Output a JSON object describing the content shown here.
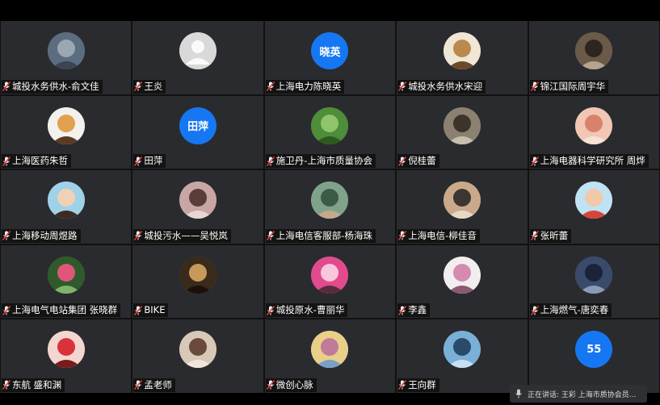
{
  "participants": [
    {
      "name": "城投水务供水-俞文佳",
      "avatar": {
        "type": "pic",
        "colors": [
          "#5b6d7e",
          "#9aa8b4",
          "#3a4452"
        ]
      }
    },
    {
      "name": "王炎",
      "avatar": {
        "type": "default"
      }
    },
    {
      "name": "上海电力陈晓英",
      "avatar": {
        "type": "text",
        "text": "晓英"
      }
    },
    {
      "name": "城投水务供水宋迎",
      "avatar": {
        "type": "pic",
        "colors": [
          "#efe6d6",
          "#b98a4b",
          "#6b4a2b"
        ]
      }
    },
    {
      "name": "锦江国际周宇华",
      "avatar": {
        "type": "pic",
        "colors": [
          "#6a5a48",
          "#2d2620",
          "#b7a48c"
        ]
      }
    },
    {
      "name": "上海医药朱哲",
      "avatar": {
        "type": "pic",
        "colors": [
          "#f3f1ee",
          "#e0a050",
          "#5a3a20"
        ]
      }
    },
    {
      "name": "田萍",
      "avatar": {
        "type": "text",
        "text": "田萍"
      }
    },
    {
      "name": "施卫丹-上海市质量协会",
      "avatar": {
        "type": "pic",
        "colors": [
          "#4e8d3a",
          "#8fc46a",
          "#2c5a1e"
        ]
      }
    },
    {
      "name": "倪桂蕾",
      "avatar": {
        "type": "pic",
        "colors": [
          "#8a8170",
          "#3a342b",
          "#c7bfae"
        ]
      }
    },
    {
      "name": "上海电器科学研究所 周烨",
      "avatar": {
        "type": "pic",
        "colors": [
          "#f2c6b4",
          "#d9826b",
          "#f6e3d6"
        ]
      }
    },
    {
      "name": "上海移动周煜路",
      "avatar": {
        "type": "pic",
        "colors": [
          "#9fd2e8",
          "#f1d1b5",
          "#3b2b22"
        ]
      }
    },
    {
      "name": "城投污水——吴悦岚",
      "avatar": {
        "type": "pic",
        "colors": [
          "#c8a6a4",
          "#5a3c3a",
          "#e8d6d4"
        ]
      }
    },
    {
      "name": "上海电信客服部-杨海珠",
      "avatar": {
        "type": "pic",
        "colors": [
          "#7fa38a",
          "#3d5a45",
          "#c3a890"
        ]
      }
    },
    {
      "name": "上海电信-柳佳音",
      "avatar": {
        "type": "pic",
        "colors": [
          "#caa98a",
          "#3b3631",
          "#e7d8c6"
        ]
      }
    },
    {
      "name": "张昕蕾",
      "avatar": {
        "type": "pic",
        "colors": [
          "#bfe3f5",
          "#f1c9a8",
          "#d9443a"
        ]
      }
    },
    {
      "name": "上海电气电站集团 张晓群",
      "avatar": {
        "type": "pic",
        "colors": [
          "#2f5a2c",
          "#e0567a",
          "#7fb36a"
        ]
      }
    },
    {
      "name": "BIKE",
      "avatar": {
        "type": "pic",
        "colors": [
          "#3a2a1a",
          "#c79a5a",
          "#1a120a"
        ]
      }
    },
    {
      "name": "城投原水-曹丽华",
      "avatar": {
        "type": "pic",
        "colors": [
          "#e24a8e",
          "#f7c7dc",
          "#5a2a3e"
        ]
      }
    },
    {
      "name": "李鑫",
      "avatar": {
        "type": "pic",
        "colors": [
          "#f2eef0",
          "#d58ab0",
          "#8a5a70"
        ]
      }
    },
    {
      "name": "上海燃气-唐奕春",
      "avatar": {
        "type": "pic",
        "colors": [
          "#3a4a6a",
          "#1a2338",
          "#8a9ab8"
        ]
      }
    },
    {
      "name": "东航 盛和渊",
      "avatar": {
        "type": "pic",
        "colors": [
          "#f3d6d0",
          "#d8323a",
          "#7a1a1a"
        ]
      }
    },
    {
      "name": "孟老师",
      "avatar": {
        "type": "pic",
        "colors": [
          "#d8c8b8",
          "#6a4a3a",
          "#f0e6dc"
        ]
      }
    },
    {
      "name": "微创心脉",
      "avatar": {
        "type": "pic",
        "colors": [
          "#e8d088",
          "#c07a9a",
          "#7aa0c8"
        ]
      }
    },
    {
      "name": "王向群",
      "avatar": {
        "type": "pic",
        "colors": [
          "#7ab0d8",
          "#2a4a6a",
          "#c8e0f0"
        ]
      }
    },
    {
      "name": "",
      "avatar": {
        "type": "text",
        "text": "55"
      }
    }
  ],
  "speaking": {
    "text": "正在讲话: 王彩 上海市质协会员..."
  },
  "colors": {
    "tile": "#2a2b2e",
    "accent": "#1677f2",
    "mic_red": "#e53935"
  },
  "icons": {
    "mic": "mic-muted-icon",
    "avatar_default": "default-avatar-icon"
  }
}
